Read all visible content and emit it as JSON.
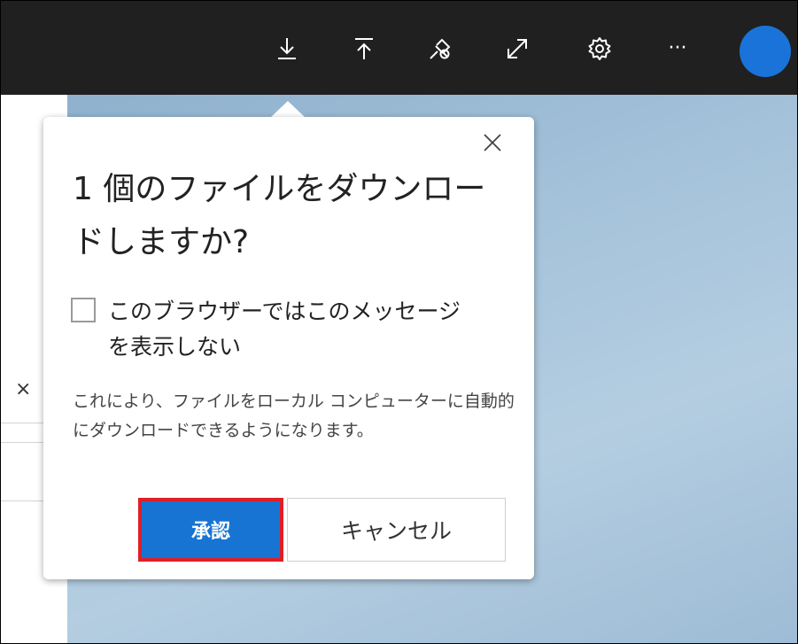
{
  "toolbar": {
    "icons": [
      "download-icon",
      "upload-icon",
      "pin-off-icon",
      "expand-icon",
      "settings-gear-icon",
      "more-icon"
    ],
    "more_label": "···",
    "avatar_color": "#1a73d8"
  },
  "left_panel": {
    "close_label": "×"
  },
  "dialog": {
    "close_label": "×",
    "title": "1 個のファイルをダウンロードしますか?",
    "checkbox_label": "このブラウザーではこのメッセージを表示しない",
    "checkbox_checked": false,
    "description": "これにより、ファイルをローカル コンピューターに自動的にダウンロードできるようになります。",
    "approve_label": "承認",
    "cancel_label": "キャンセル"
  },
  "colors": {
    "toolbar_bg": "#202020",
    "primary_button": "#1874d2",
    "highlight_border": "#e01e26",
    "background_blue": "#a7c4db"
  }
}
